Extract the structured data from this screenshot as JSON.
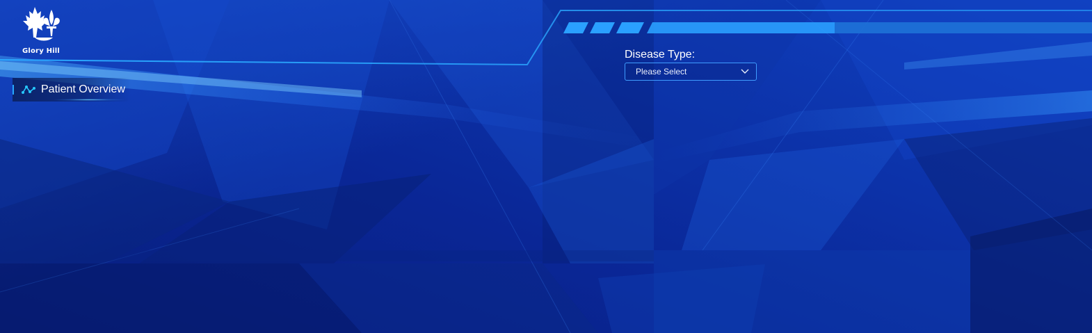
{
  "brand": {
    "name": "Glory Hill",
    "logo_icon": "fleur-de-lis-maple-icon"
  },
  "section": {
    "title": "Patient Overview",
    "icon": "network-nodes-icon"
  },
  "filters": {
    "disease_type": {
      "label": "Disease Type:",
      "selected": "Please Select",
      "icon": "chevron-down-icon"
    }
  },
  "colors": {
    "background": "#0b2a9e",
    "accent": "#27a8ff",
    "select_border": "#3f9dff",
    "text": "#ffffff"
  }
}
